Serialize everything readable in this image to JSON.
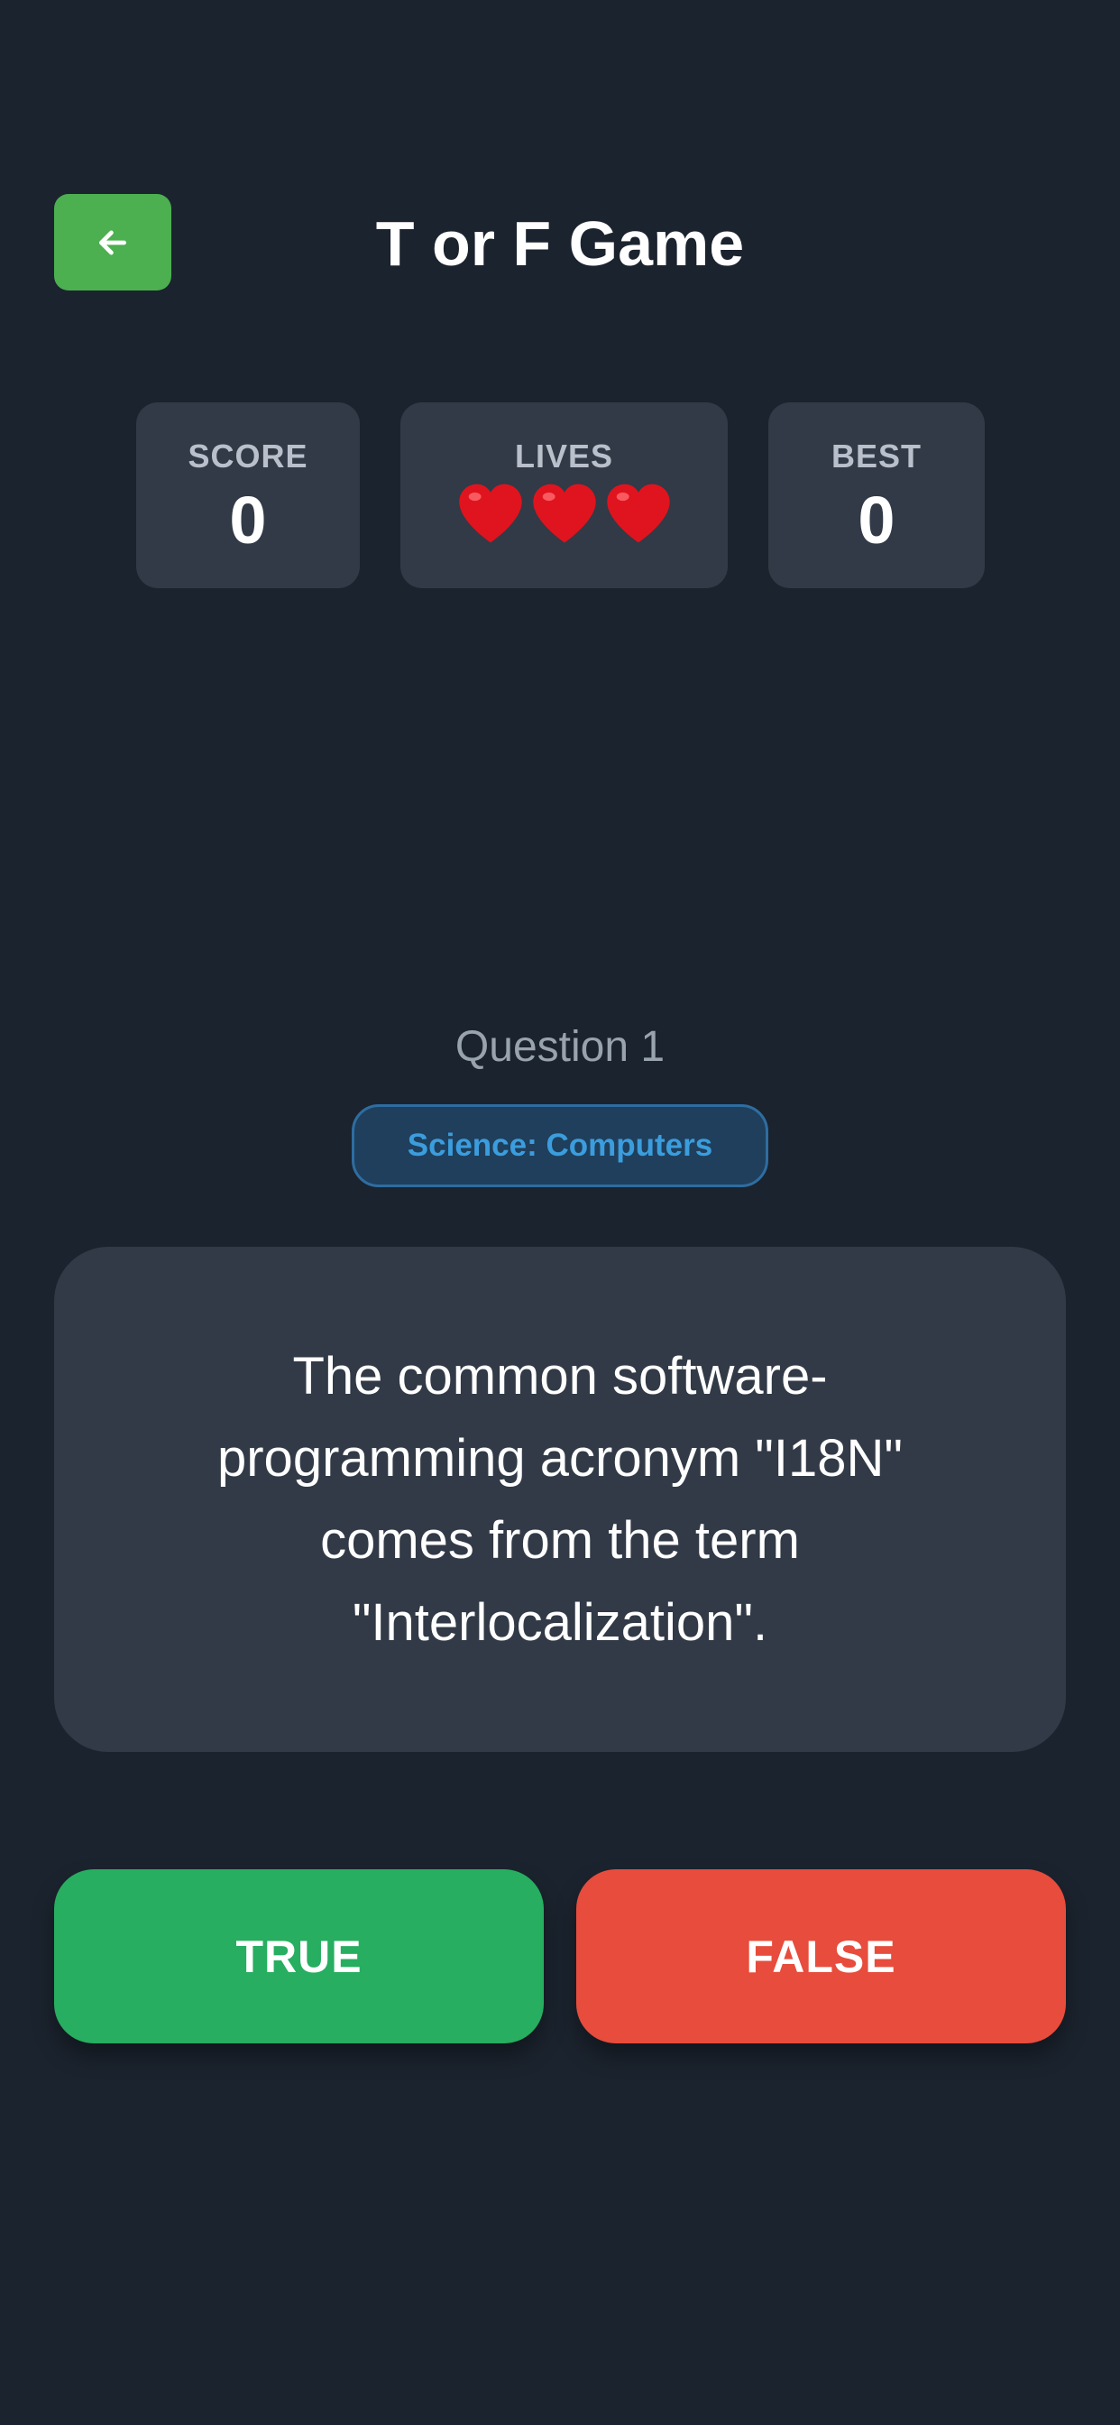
{
  "header": {
    "title": "T or F Game",
    "back_icon": "arrow-left-icon",
    "back_color": "#4caf50"
  },
  "stats": {
    "score": {
      "label": "SCORE",
      "value": "0"
    },
    "lives": {
      "label": "LIVES",
      "count": 3,
      "icon": "heart-icon",
      "color": "#e0141e"
    },
    "best": {
      "label": "BEST",
      "value": "0"
    }
  },
  "question": {
    "number_text": "Question 1",
    "category": "Science: Computers",
    "text": "The common software-programming acronym \"I18N\" comes from the term \"Interlocalization\"."
  },
  "answers": {
    "true_label": "TRUE",
    "false_label": "FALSE",
    "true_color": "#27ae60",
    "false_color": "#e74c3c"
  }
}
